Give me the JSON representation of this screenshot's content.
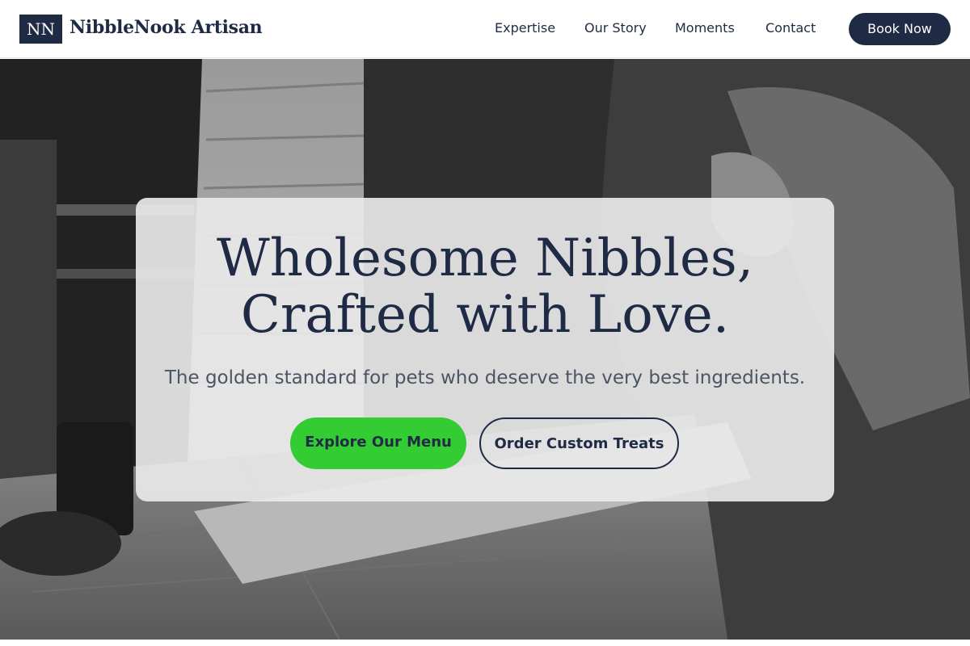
{
  "header": {
    "logo_mark": "NN",
    "brand": "NibbleNook Artisan",
    "nav": [
      "Expertise",
      "Our Story",
      "Moments",
      "Contact"
    ],
    "cta": "Book Now"
  },
  "hero": {
    "headline_line1": "Wholesome Nibbles,",
    "headline_line2": "Crafted with Love.",
    "subheadline": "The golden standard for pets who deserve the very best ingredients.",
    "primary_button": "Explore Our Menu",
    "secondary_button": "Order Custom Treats"
  },
  "colors": {
    "navy": "#1f2a44",
    "accent_green": "#33cc33",
    "card_background": "#e9e9ea",
    "subtext": "#4b5563"
  }
}
